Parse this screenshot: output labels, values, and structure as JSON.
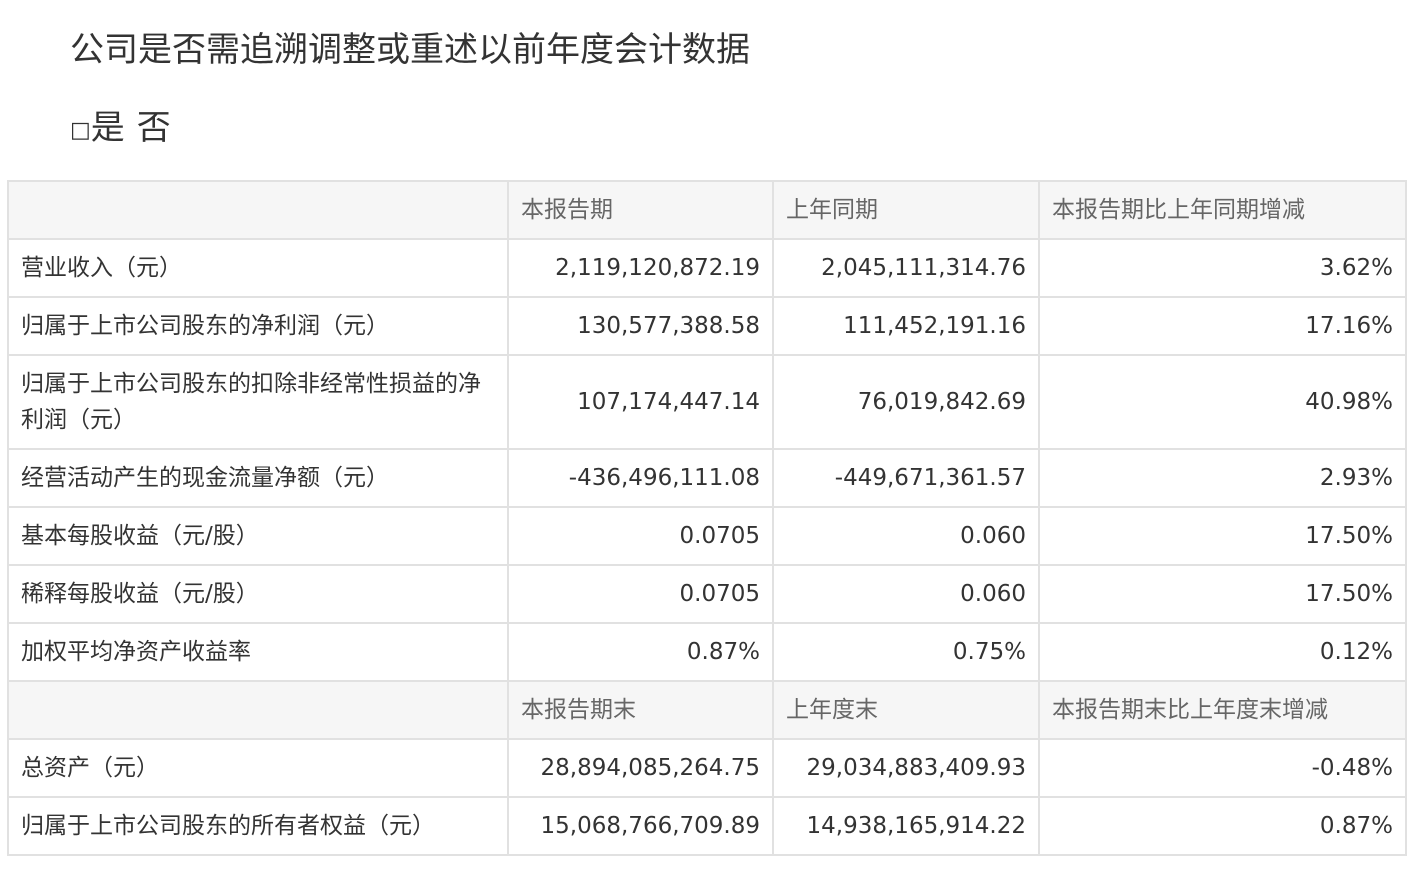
{
  "heading": "公司是否需追溯调整或重述以前年度会计数据",
  "choice": {
    "yes_box": "□",
    "yes_label": "是",
    "no_box": "",
    "no_label": "否"
  },
  "table": {
    "header1": [
      "",
      "本报告期",
      "上年同期",
      "本报告期比上年同期增减"
    ],
    "rows1": [
      [
        "营业收入（元）",
        "2,119,120,872.19",
        "2,045,111,314.76",
        "3.62%"
      ],
      [
        "归属于上市公司股东的净利润（元）",
        "130,577,388.58",
        "111,452,191.16",
        "17.16%"
      ],
      [
        "归属于上市公司股东的扣除非经常性损益的净利润（元）",
        "107,174,447.14",
        "76,019,842.69",
        "40.98%"
      ],
      [
        "经营活动产生的现金流量净额（元）",
        "-436,496,111.08",
        "-449,671,361.57",
        "2.93%"
      ],
      [
        "基本每股收益（元/股）",
        "0.0705",
        "0.060",
        "17.50%"
      ],
      [
        "稀释每股收益（元/股）",
        "0.0705",
        "0.060",
        "17.50%"
      ],
      [
        "加权平均净资产收益率",
        "0.87%",
        "0.75%",
        "0.12%"
      ]
    ],
    "header2": [
      "",
      "本报告期末",
      "上年度末",
      "本报告期末比上年度末增减"
    ],
    "rows2": [
      [
        "总资产（元）",
        "28,894,085,264.75",
        "29,034,883,409.93",
        "-0.48%"
      ],
      [
        "归属于上市公司股东的所有者权益（元）",
        "15,068,766,709.89",
        "14,938,165,914.22",
        "0.87%"
      ]
    ]
  }
}
